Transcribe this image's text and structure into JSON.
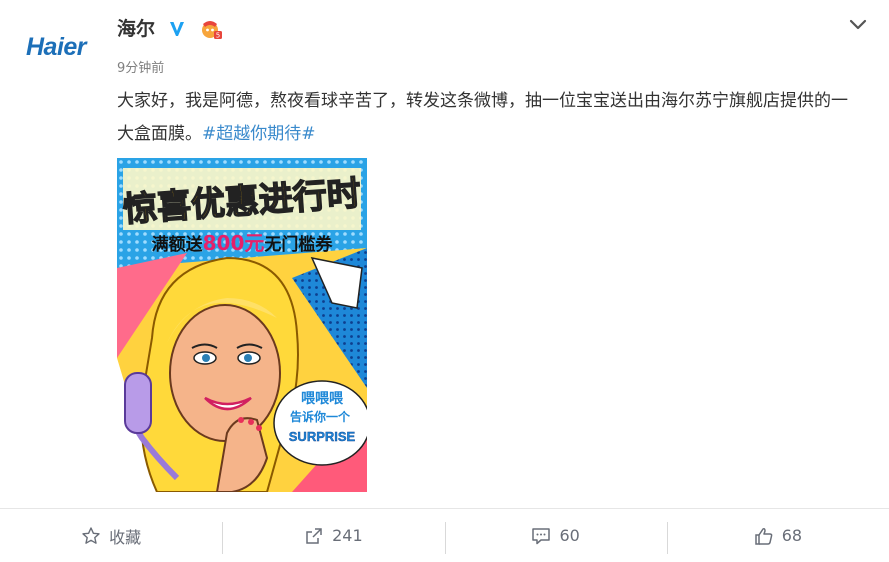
{
  "post": {
    "avatar_text": "Haier",
    "nickname": "海尔",
    "time": "9分钟前",
    "text_before": "大家好，我是阿德，熬夜看球辛苦了，转发这条微博，抽一位宝宝送出由海尔苏宁旗舰店提供的一大盒面膜。",
    "hashtag": "#超越你期待#",
    "colors": {
      "link": "#3a8acc",
      "brand": "#1c6fb8",
      "vip": "#1da1f2"
    }
  },
  "image": {
    "headline": "惊喜优惠进行时",
    "subline_prefix": "满额送",
    "subline_amount": "800元",
    "subline_suffix": "无门槛券",
    "bubble_line1": "喂喂喂",
    "bubble_line2": "告诉你一个",
    "bubble_line3": "SURPRISE"
  },
  "actions": {
    "favorite_label": "收藏",
    "repost_count": "241",
    "comment_count": "60",
    "like_count": "68"
  },
  "icons": [
    "vip-verified-icon",
    "badge-icon",
    "chevron-down-icon",
    "star-icon",
    "share-icon",
    "comment-icon",
    "thumbs-up-icon"
  ]
}
